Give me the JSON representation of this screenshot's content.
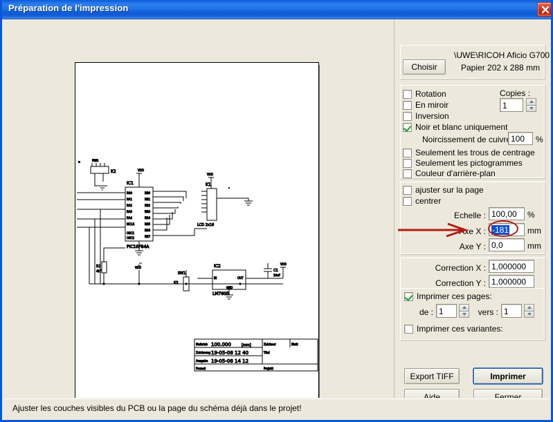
{
  "window": {
    "title": "Préparation de l'impression",
    "close_icon": "close-icon"
  },
  "statusbar": {
    "text": "Ajuster les couches visibles du PCB ou la page du schéma déjà dans le projet!"
  },
  "printer": {
    "choose_button": "Choisir",
    "name": "\\UWE\\RICOH Aficio G700",
    "paper": "Papier 202 x 288 mm"
  },
  "options": {
    "rotation": {
      "label": "Rotation",
      "checked": false
    },
    "mirror": {
      "label": "En miroir",
      "checked": false
    },
    "inversion": {
      "label": "Inversion",
      "checked": false
    },
    "blackwhite": {
      "label": "Noir et blanc uniquement",
      "checked": true
    },
    "copper_label": "Noircissement de cuivre:",
    "copper_value": "100",
    "copper_unit": "%",
    "centering_holes": {
      "label": "Seulement les trous de centrage",
      "checked": false
    },
    "pictograms": {
      "label": "Seulement les pictogrammes",
      "checked": false
    },
    "background_color": {
      "label": "Couleur d'arrière-plan",
      "checked": false
    }
  },
  "copies": {
    "label": "Copies :",
    "value": "1"
  },
  "placement": {
    "fit_page": {
      "label": "ajuster sur la page",
      "checked": false
    },
    "center": {
      "label": "centrer",
      "checked": false
    },
    "scale_label": "Echelle :",
    "scale_value": "100,00",
    "scale_unit": "%",
    "axis_x_label": "Axe X :",
    "axis_x_value": "-181",
    "axis_x_unit": "mm",
    "axis_y_label": "Axe Y :",
    "axis_y_value": "0,0",
    "axis_y_unit": "mm"
  },
  "correction": {
    "x_label": "Correction X :",
    "x_value": "1,000000",
    "y_label": "Correction Y :",
    "y_value": "1,000000"
  },
  "pages": {
    "print_pages": {
      "label": "Imprimer ces pages:",
      "checked": true
    },
    "from_label": "de :",
    "from_value": "1",
    "to_label": "vers :",
    "to_value": "1",
    "print_variants": {
      "label": "Imprimer ces variantes:",
      "checked": false
    }
  },
  "buttons": {
    "export_tiff": "Export TIFF",
    "imprimer": "Imprimer",
    "aide": "Aide",
    "fermer": "Fermer"
  },
  "annotations": {
    "arrow": "red-arrow-annotation",
    "ellipse": "red-ellipse-annotation"
  },
  "preview": {
    "name": "print-preview-page",
    "content": "PCB schematic drawing with PIC16F84A microcontroller, connectors and LM7805 regulator"
  },
  "colors": {
    "titlebar": "#1F74E8",
    "window_bg": "#ECE9DC",
    "annotation_red": "#B41A14",
    "selection_blue": "#0A52CC",
    "check_green": "#1C9B2E"
  }
}
